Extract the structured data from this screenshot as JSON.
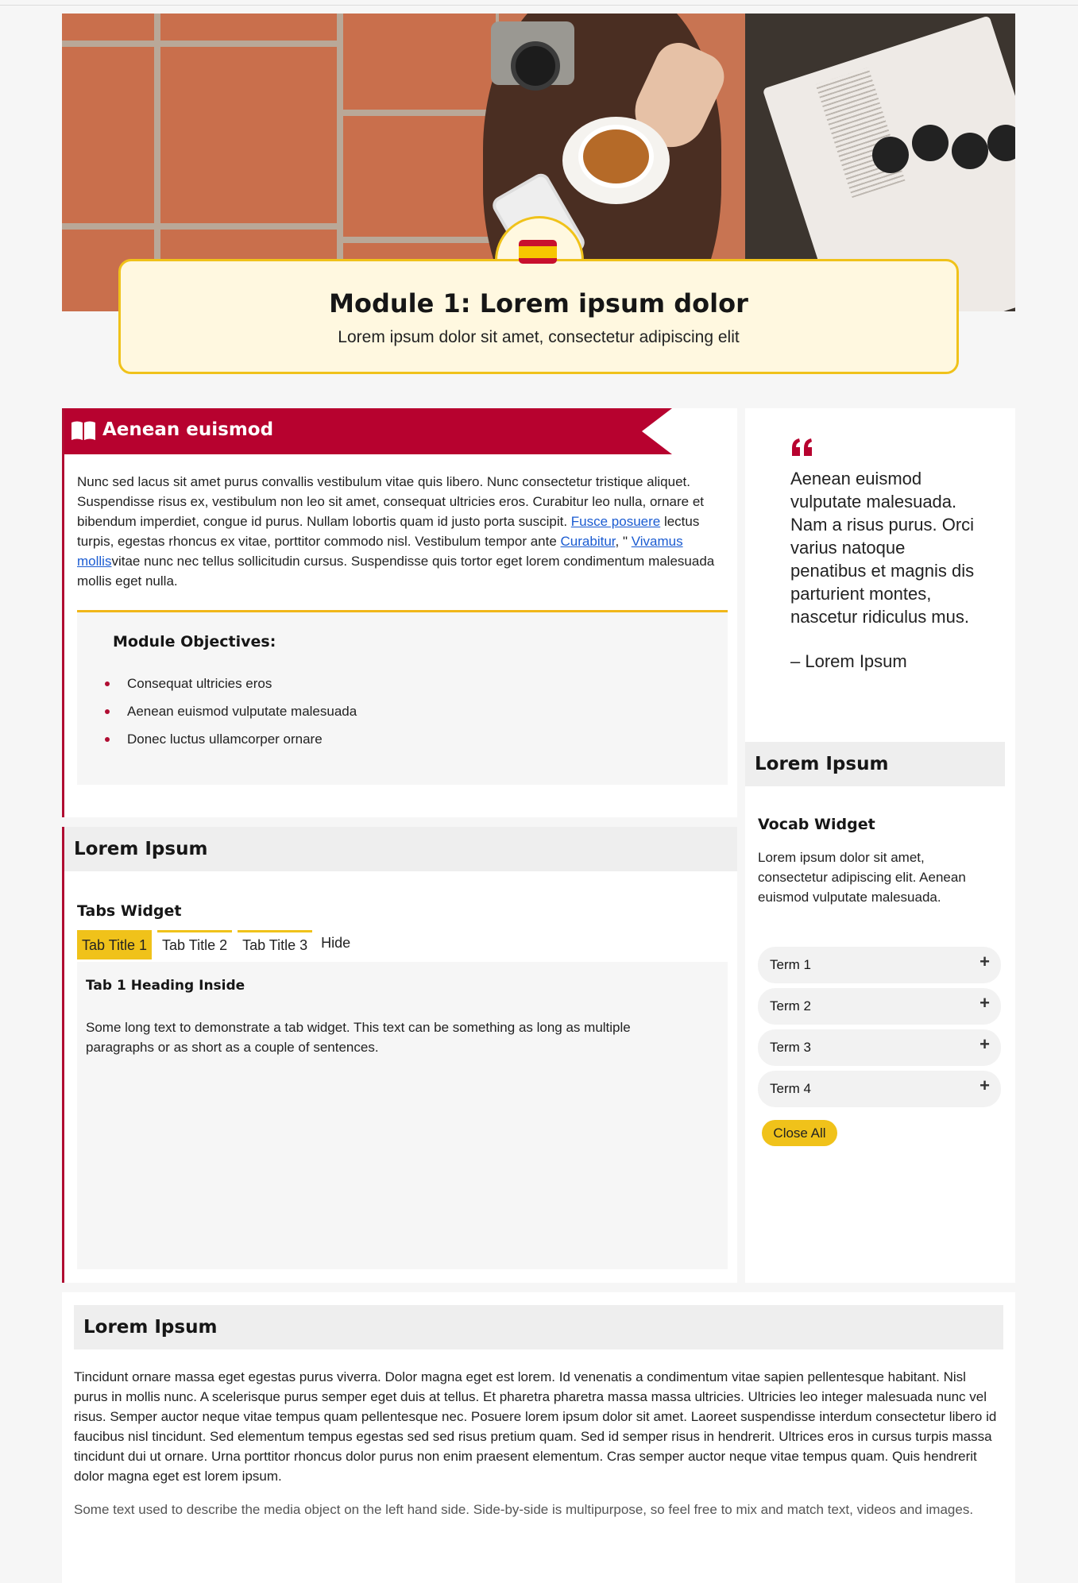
{
  "hero": {
    "title": "Module 1: Lorem ipsum dolor",
    "subtitle": "Lorem ipsum dolor sit amet, consectetur adipiscing elit",
    "flag_icon": "spain-flag-icon"
  },
  "intro_card": {
    "banner_icon": "book-icon",
    "banner_title": "Aenean euismod",
    "paragraph_start": "Nunc sed lacus sit amet purus convallis vestibulum vitae quis libero. Nunc consectetur tristique aliquet. Suspendisse risus ex, vestibulum non leo sit amet, consequat ultricies eros. Curabitur leo nulla, ornare et bibendum imperdiet, congue id purus. Nullam lobortis quam id justo porta suscipit. ",
    "link1": "Fusce posuere",
    "paragraph_mid1": " lectus turpis, egestas rhoncus ex vitae, porttitor commodo nisl. Vestibulum tempor ante ",
    "link2": "Curabitur",
    "paragraph_mid2": ", \" ",
    "link3": "Vivamus mollis",
    "paragraph_end": "vitae nunc nec tellus sollicitudin cursus. Suspendisse quis tortor eget lorem condimentum malesuada mollis eget nulla.",
    "objectives_title": "Module Objectives:",
    "objectives": [
      "Consequat ultricies eros",
      "Aenean euismod vulputate malesuada",
      "Donec luctus ullamcorper ornare"
    ],
    "accent_color": "#b7022f",
    "highlight_color": "#f0c21a"
  },
  "quote": {
    "mark": "66",
    "text": "Aenean euismod vulputate malesuada. Nam a risus purus. Orci varius natoque penatibus et magnis dis parturient montes, nascetur ridiculus mus.",
    "author": "– Lorem Ipsum"
  },
  "tabs_card": {
    "section_title": "Lorem Ipsum",
    "widget_title": "Tabs Widget",
    "tabs": [
      "Tab Title 1",
      "Tab Title 2",
      "Tab Title 3"
    ],
    "active_tab": 0,
    "hide_label": "Hide",
    "panel_heading": "Tab 1 Heading Inside",
    "panel_text": "Some long text to demonstrate a tab widget. This text can be something as long as multiple paragraphs or as short as a couple of sentences."
  },
  "vocab_card": {
    "section_title": "Lorem Ipsum",
    "widget_title": "Vocab Widget",
    "description": "Lorem ipsum dolor sit amet, consectetur adipiscing elit. Aenean euismod vulputate malesuada.",
    "terms": [
      "Term 1",
      "Term 2",
      "Term 3",
      "Term 4"
    ],
    "expand_symbol": "+",
    "close_all_label": "Close All"
  },
  "bottom_card": {
    "section_title": "Lorem Ipsum",
    "paragraph": "Tincidunt ornare massa eget egestas purus viverra. Dolor magna eget est lorem. Id venenatis a condimentum vitae sapien pellentesque habitant. Nisl purus in mollis nunc. A scelerisque purus semper eget duis at tellus. Et pharetra pharetra massa massa ultricies. Ultricies leo integer malesuada nunc vel risus. Semper auctor neque vitae tempus quam pellentesque nec. Posuere lorem ipsum dolor sit amet. Laoreet suspendisse interdum consectetur libero id faucibus nisl tincidunt. Sed elementum tempus egestas sed sed risus pretium quam. Sed id semper risus in hendrerit. Ultrices eros in cursus turpis massa tincidunt dui ut ornare. Urna porttitor rhoncus dolor purus non enim praesent elementum. Cras semper auctor neque vitae tempus quam. Quis hendrerit dolor magna eget est lorem ipsum.",
    "media_text": "Some text used to describe the media object on the left hand side. Side-by-side is multipurpose, so feel free to mix and match text, videos and images."
  }
}
